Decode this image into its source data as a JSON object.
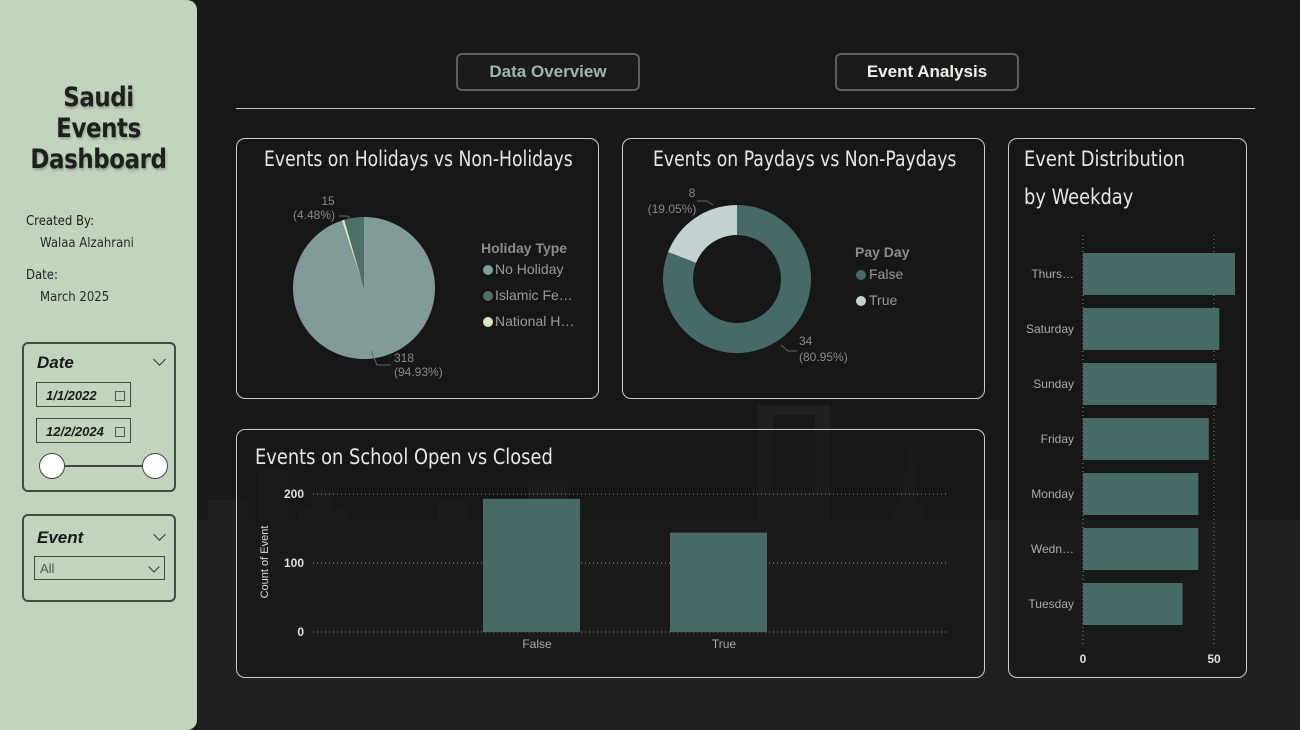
{
  "sidebar": {
    "title_lines": [
      "Saudi",
      "Events",
      "Dashboard"
    ],
    "created_by_label": "Created By:",
    "created_by_value": "Walaa Alzahrani",
    "date_label": "Date:",
    "date_value": "March 2025",
    "date_slicer": {
      "title": "Date",
      "start": "1/1/2022",
      "end": "12/2/2024"
    },
    "event_slicer": {
      "title": "Event",
      "selected": "All"
    }
  },
  "nav": {
    "overview_label": "Data Overview",
    "event_label": "Event Analysis"
  },
  "colors": {
    "accent": "#c2d4be",
    "bar": "#486a66",
    "pie_main": "#809b98",
    "pie_islamic": "#4e6e6a",
    "pie_national": "#d8e6c8",
    "donut_false": "#486a66",
    "donut_true": "#c5d1d0"
  },
  "holidays": {
    "title": "Events on Holidays vs Non-Holidays",
    "legend_title": "Holiday Type",
    "legend": [
      "No Holiday",
      "Islamic Fe…",
      "National H…"
    ],
    "label_small_count": "15",
    "label_small_pct": "(4.48%)",
    "label_big_count": "318",
    "label_big_pct": "(94.93%)"
  },
  "paydays": {
    "title": "Events on Paydays vs Non-Paydays",
    "legend_title": "Pay Day",
    "legend": [
      "False",
      "True"
    ],
    "label_true_count": "8",
    "label_true_pct": "(19.05%)",
    "label_false_count": "34",
    "label_false_pct": "(80.95%)"
  },
  "weekday": {
    "title_line1": "Event Distribution",
    "title_line2": "by Weekday"
  },
  "school": {
    "title": "Events on School Open vs Closed"
  },
  "chart_data": [
    {
      "type": "pie",
      "title": "Events on Holidays vs Non-Holidays",
      "legend_title": "Holiday Type",
      "categories": [
        "No Holiday",
        "Islamic Fe…",
        "National H…"
      ],
      "values": [
        318,
        15,
        2
      ]
    },
    {
      "type": "pie",
      "subtype": "donut",
      "title": "Events on Paydays vs Non-Paydays",
      "legend_title": "Pay Day",
      "categories": [
        "False",
        "True"
      ],
      "values": [
        34,
        8
      ]
    },
    {
      "type": "bar",
      "orientation": "horizontal",
      "title": "Event Distribution by Weekday",
      "categories": [
        "Thurs…",
        "Saturday",
        "Sunday",
        "Friday",
        "Monday",
        "Wedn…",
        "Tuesday"
      ],
      "values": [
        58,
        52,
        51,
        48,
        44,
        44,
        38
      ],
      "xlim": [
        0,
        58
      ],
      "x_ticks": [
        "0",
        "50"
      ]
    },
    {
      "type": "bar",
      "title": "Events on School Open vs Closed",
      "categories": [
        "False",
        "True"
      ],
      "values": [
        193,
        144
      ],
      "ylabel": "Count of Event",
      "ylim": [
        0,
        200
      ],
      "y_ticks": [
        "0",
        "100",
        "200"
      ]
    }
  ]
}
